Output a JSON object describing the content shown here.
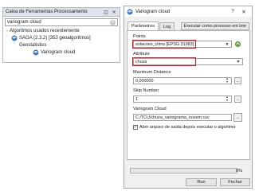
{
  "toolbox": {
    "title": "Caixa de Ferramentas Processamento",
    "search_value": "variogram cloud",
    "tree": [
      {
        "label": "Algoritmos usados recentemente"
      },
      {
        "label": "SAGA (2.3.2) [353 geoalgoritmos]"
      },
      {
        "label": "Geostatistics"
      },
      {
        "label": "Variogram cloud"
      }
    ]
  },
  "dialog": {
    "title": "Variogram cloud",
    "help_label": "?",
    "close_label": "✕",
    "tabs": [
      "Parâmetros",
      "Log"
    ],
    "batch_button": "Executar como processo em lote",
    "fields": {
      "points_label": "Points",
      "points_value": "estacoes_clima [EPSG:31983]",
      "attribute_label": "Attribute",
      "attribute_value": "chuva",
      "max_distance_label": "Maximum Distance",
      "max_distance_value": "0,000000",
      "skip_label": "Skip Number",
      "skip_value": "1",
      "output_label": "Variogram Cloud",
      "output_value": "C:/TCU/chuva_variograma_nuvem.csv",
      "browse_label": "...",
      "open_after_label": "Abrir arquivo de saída depois executar o algoritmo",
      "open_after_checked": true
    },
    "progress_fraction": 0,
    "progress_text": "0%",
    "run_button": "Run",
    "close_button": "Fechar"
  },
  "colors": {
    "highlight": "#e0141c",
    "qgis_green": "#5da13a",
    "saga_blue": "#2e73c4"
  },
  "icons": [
    "float-icon",
    "close-icon",
    "clear-search-icon",
    "saga-icon",
    "variogram-icon",
    "select-layer-icon",
    "chevron-down-icon"
  ]
}
